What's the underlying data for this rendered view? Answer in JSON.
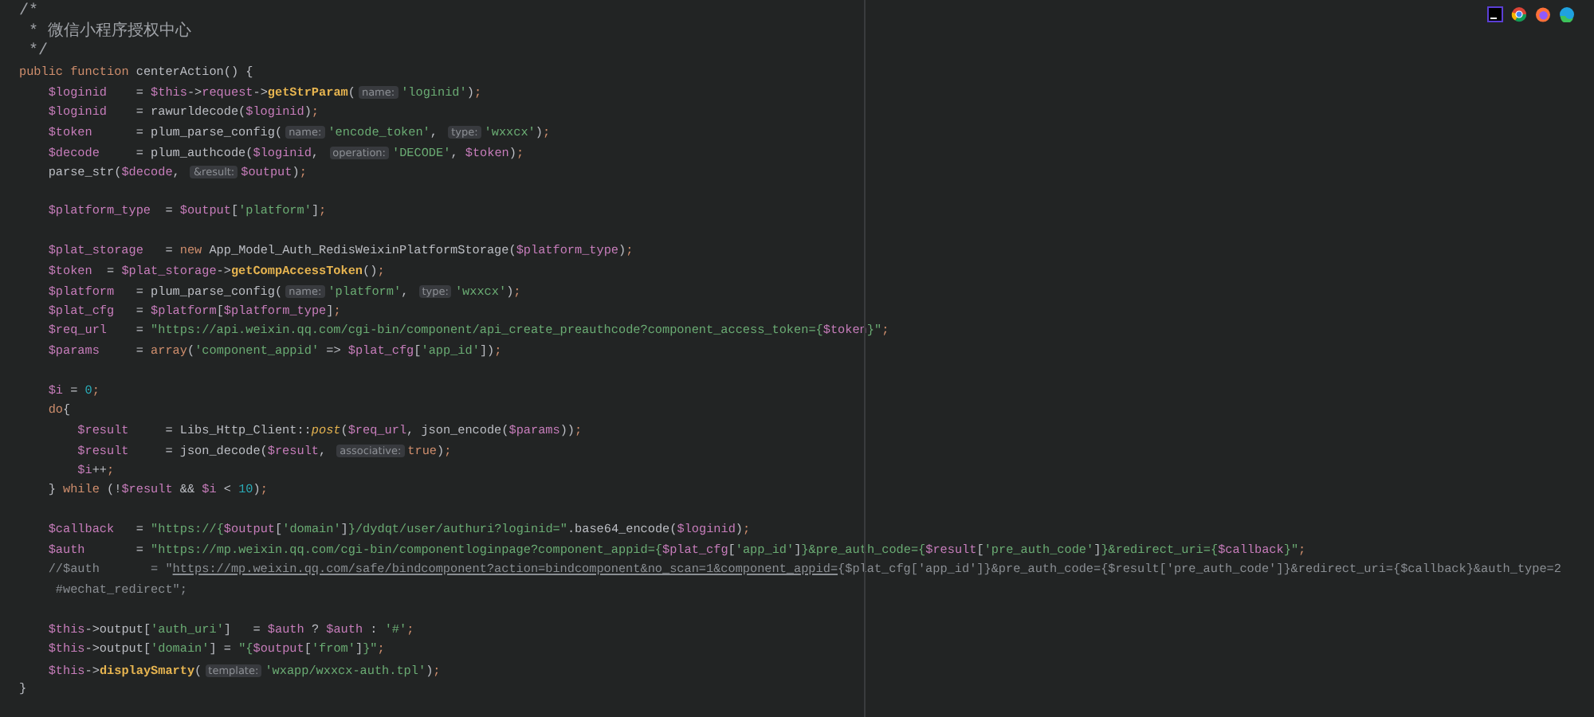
{
  "editor": {
    "lines": [
      {
        "kind": "code",
        "segments": [
          {
            "kind": "doc",
            "text": "/*"
          }
        ]
      },
      {
        "kind": "code",
        "segments": [
          {
            "kind": "doc",
            "text": " * 微信小程序授权中心"
          }
        ]
      },
      {
        "kind": "code",
        "segments": [
          {
            "kind": "doc",
            "text": " */"
          }
        ]
      },
      {
        "kind": "code",
        "segments": [
          {
            "kind": "kw",
            "text": "public function "
          },
          {
            "kind": "plain",
            "text": "centerAction() {"
          }
        ],
        "children": [
          {
            "kind": "code",
            "segments": [
              {
                "kind": "var",
                "text": "$loginid"
              },
              {
                "kind": "plain",
                "text": "    = "
              },
              {
                "kind": "var",
                "text": "$this"
              },
              {
                "kind": "plain",
                "text": "->"
              },
              {
                "kind": "var",
                "text": "request"
              },
              {
                "kind": "plain",
                "text": "->"
              },
              {
                "kind": "call",
                "text": "getStrParam"
              },
              {
                "kind": "plain",
                "text": "("
              },
              {
                "kind": "hint",
                "text": "name:"
              },
              {
                "kind": "str",
                "text": "'loginid'"
              },
              {
                "kind": "plain",
                "text": ")"
              },
              {
                "kind": "kw",
                "text": ";"
              }
            ]
          },
          {
            "kind": "code",
            "segments": [
              {
                "kind": "var",
                "text": "$loginid"
              },
              {
                "kind": "plain",
                "text": "    = rawurldecode("
              },
              {
                "kind": "var",
                "text": "$loginid"
              },
              {
                "kind": "plain",
                "text": ")"
              },
              {
                "kind": "kw",
                "text": ";"
              }
            ]
          },
          {
            "kind": "code",
            "segments": [
              {
                "kind": "var",
                "text": "$token"
              },
              {
                "kind": "plain",
                "text": "      = plum_parse_config("
              },
              {
                "kind": "hint",
                "text": "name:"
              },
              {
                "kind": "str",
                "text": "'encode_token'"
              },
              {
                "kind": "plain",
                "text": ", "
              },
              {
                "kind": "hint",
                "text": "type:"
              },
              {
                "kind": "str",
                "text": "'wxxcx'"
              },
              {
                "kind": "plain",
                "text": ")"
              },
              {
                "kind": "kw",
                "text": ";"
              }
            ]
          },
          {
            "kind": "code",
            "segments": [
              {
                "kind": "var",
                "text": "$decode"
              },
              {
                "kind": "plain",
                "text": "     = plum_authcode("
              },
              {
                "kind": "var",
                "text": "$loginid"
              },
              {
                "kind": "plain",
                "text": ", "
              },
              {
                "kind": "hint",
                "text": "operation:"
              },
              {
                "kind": "str",
                "text": "'DECODE'"
              },
              {
                "kind": "plain",
                "text": ", "
              },
              {
                "kind": "var",
                "text": "$token"
              },
              {
                "kind": "plain",
                "text": ")"
              },
              {
                "kind": "kw",
                "text": ";"
              }
            ]
          },
          {
            "kind": "code",
            "segments": [
              {
                "kind": "plain",
                "text": "parse_str("
              },
              {
                "kind": "var",
                "text": "$decode"
              },
              {
                "kind": "plain",
                "text": ", "
              },
              {
                "kind": "hint",
                "text": "&result:"
              },
              {
                "kind": "var",
                "text": "$output"
              },
              {
                "kind": "plain",
                "text": ")"
              },
              {
                "kind": "kw",
                "text": ";"
              }
            ]
          },
          {
            "kind": "blank"
          },
          {
            "kind": "code",
            "segments": [
              {
                "kind": "var",
                "text": "$platform_type"
              },
              {
                "kind": "plain",
                "text": "  = "
              },
              {
                "kind": "var",
                "text": "$output"
              },
              {
                "kind": "plain",
                "text": "["
              },
              {
                "kind": "str",
                "text": "'platform'"
              },
              {
                "kind": "plain",
                "text": "]"
              },
              {
                "kind": "kw",
                "text": ";"
              }
            ]
          },
          {
            "kind": "blank"
          },
          {
            "kind": "code",
            "segments": [
              {
                "kind": "var",
                "text": "$plat_storage"
              },
              {
                "kind": "plain",
                "text": "   = "
              },
              {
                "kind": "kw",
                "text": "new"
              },
              {
                "kind": "plain",
                "text": " App_Model_Auth_RedisWeixinPlatformStorage("
              },
              {
                "kind": "var",
                "text": "$platform_type"
              },
              {
                "kind": "plain",
                "text": ")"
              },
              {
                "kind": "kw",
                "text": ";"
              }
            ]
          },
          {
            "kind": "code",
            "segments": [
              {
                "kind": "var",
                "text": "$token"
              },
              {
                "kind": "plain",
                "text": "  = "
              },
              {
                "kind": "var",
                "text": "$plat_storage"
              },
              {
                "kind": "plain",
                "text": "->"
              },
              {
                "kind": "call",
                "text": "getCompAccessToken"
              },
              {
                "kind": "plain",
                "text": "()"
              },
              {
                "kind": "kw",
                "text": ";"
              }
            ]
          },
          {
            "kind": "code",
            "segments": [
              {
                "kind": "var",
                "text": "$platform"
              },
              {
                "kind": "plain",
                "text": "   = plum_parse_config("
              },
              {
                "kind": "hint",
                "text": "name:"
              },
              {
                "kind": "str",
                "text": "'platform'"
              },
              {
                "kind": "plain",
                "text": ", "
              },
              {
                "kind": "hint",
                "text": "type:"
              },
              {
                "kind": "str",
                "text": "'wxxcx'"
              },
              {
                "kind": "plain",
                "text": ")"
              },
              {
                "kind": "kw",
                "text": ";"
              }
            ]
          },
          {
            "kind": "code",
            "segments": [
              {
                "kind": "var",
                "text": "$plat_cfg"
              },
              {
                "kind": "plain",
                "text": "   = "
              },
              {
                "kind": "var",
                "text": "$platform"
              },
              {
                "kind": "plain",
                "text": "["
              },
              {
                "kind": "var",
                "text": "$platform_type"
              },
              {
                "kind": "plain",
                "text": "]"
              },
              {
                "kind": "kw",
                "text": ";"
              }
            ]
          },
          {
            "kind": "code",
            "segments": [
              {
                "kind": "var",
                "text": "$req_url"
              },
              {
                "kind": "plain",
                "text": "    = "
              },
              {
                "kind": "str",
                "text": "\"https://api.weixin.qq.com/cgi-bin/component/api_create_preauthcode?component_access_token={"
              },
              {
                "kind": "var",
                "text": "$token"
              },
              {
                "kind": "str",
                "text": "}\""
              },
              {
                "kind": "kw",
                "text": ";"
              }
            ]
          },
          {
            "kind": "code",
            "segments": [
              {
                "kind": "var",
                "text": "$params"
              },
              {
                "kind": "plain",
                "text": "     = "
              },
              {
                "kind": "kw",
                "text": "array"
              },
              {
                "kind": "plain",
                "text": "("
              },
              {
                "kind": "str",
                "text": "'component_appid'"
              },
              {
                "kind": "plain",
                "text": " => "
              },
              {
                "kind": "var",
                "text": "$plat_cfg"
              },
              {
                "kind": "plain",
                "text": "["
              },
              {
                "kind": "str",
                "text": "'app_id'"
              },
              {
                "kind": "plain",
                "text": "])"
              },
              {
                "kind": "kw",
                "text": ";"
              }
            ]
          },
          {
            "kind": "blank"
          },
          {
            "kind": "code",
            "segments": [
              {
                "kind": "var",
                "text": "$i"
              },
              {
                "kind": "plain",
                "text": " = "
              },
              {
                "kind": "num",
                "text": "0"
              },
              {
                "kind": "kw",
                "text": ";"
              }
            ]
          },
          {
            "kind": "code",
            "segments": [
              {
                "kind": "kw",
                "text": "do"
              },
              {
                "kind": "plain",
                "text": "{"
              }
            ],
            "children": [
              {
                "kind": "code",
                "segments": [
                  {
                    "kind": "var",
                    "text": "$result"
                  },
                  {
                    "kind": "plain",
                    "text": "     = Libs_Http_Client::"
                  },
                  {
                    "kind": "fnit",
                    "text": "post"
                  },
                  {
                    "kind": "plain",
                    "text": "("
                  },
                  {
                    "kind": "var",
                    "text": "$req_url"
                  },
                  {
                    "kind": "plain",
                    "text": ", json_encode("
                  },
                  {
                    "kind": "var",
                    "text": "$params"
                  },
                  {
                    "kind": "plain",
                    "text": "))"
                  },
                  {
                    "kind": "kw",
                    "text": ";"
                  }
                ]
              },
              {
                "kind": "code",
                "segments": [
                  {
                    "kind": "var",
                    "text": "$result"
                  },
                  {
                    "kind": "plain",
                    "text": "     = json_decode("
                  },
                  {
                    "kind": "var",
                    "text": "$result"
                  },
                  {
                    "kind": "plain",
                    "text": ", "
                  },
                  {
                    "kind": "hint",
                    "text": "associative:"
                  },
                  {
                    "kind": "kw",
                    "text": "true"
                  },
                  {
                    "kind": "plain",
                    "text": ")"
                  },
                  {
                    "kind": "kw",
                    "text": ";"
                  }
                ]
              },
              {
                "kind": "code",
                "segments": [
                  {
                    "kind": "var",
                    "text": "$i"
                  },
                  {
                    "kind": "plain",
                    "text": "++"
                  },
                  {
                    "kind": "kw",
                    "text": ";"
                  }
                ]
              }
            ]
          },
          {
            "kind": "code",
            "segments": [
              {
                "kind": "plain",
                "text": "} "
              },
              {
                "kind": "kw",
                "text": "while"
              },
              {
                "kind": "plain",
                "text": " (!"
              },
              {
                "kind": "var",
                "text": "$result"
              },
              {
                "kind": "plain",
                "text": " && "
              },
              {
                "kind": "var",
                "text": "$i"
              },
              {
                "kind": "plain",
                "text": " < "
              },
              {
                "kind": "num",
                "text": "10"
              },
              {
                "kind": "plain",
                "text": ")"
              },
              {
                "kind": "kw",
                "text": ";"
              }
            ]
          },
          {
            "kind": "blank"
          },
          {
            "kind": "code",
            "segments": [
              {
                "kind": "var",
                "text": "$callback"
              },
              {
                "kind": "plain",
                "text": "   = "
              },
              {
                "kind": "str",
                "text": "\"https://{"
              },
              {
                "kind": "var",
                "text": "$output"
              },
              {
                "kind": "plain",
                "text": "["
              },
              {
                "kind": "str",
                "text": "'domain'"
              },
              {
                "kind": "plain",
                "text": "]"
              },
              {
                "kind": "str",
                "text": "}/dydqt/user/authuri?loginid=\""
              },
              {
                "kind": "plain",
                "text": ".base64_encode("
              },
              {
                "kind": "var",
                "text": "$loginid"
              },
              {
                "kind": "plain",
                "text": ")"
              },
              {
                "kind": "kw",
                "text": ";"
              }
            ]
          },
          {
            "kind": "code",
            "segments": [
              {
                "kind": "var",
                "text": "$auth"
              },
              {
                "kind": "plain",
                "text": "       = "
              },
              {
                "kind": "str",
                "text": "\"https://mp.weixin.qq.com/cgi-bin/componentloginpage?component_appid={"
              },
              {
                "kind": "var",
                "text": "$plat_cfg"
              },
              {
                "kind": "plain",
                "text": "["
              },
              {
                "kind": "str",
                "text": "'app_id'"
              },
              {
                "kind": "plain",
                "text": "]"
              },
              {
                "kind": "str",
                "text": "}&pre_auth_code={"
              },
              {
                "kind": "var",
                "text": "$result"
              },
              {
                "kind": "plain",
                "text": "["
              },
              {
                "kind": "str",
                "text": "'pre_auth_code'"
              },
              {
                "kind": "plain",
                "text": "]"
              },
              {
                "kind": "str",
                "text": "}&redirect_uri={"
              },
              {
                "kind": "var",
                "text": "$callback"
              },
              {
                "kind": "str",
                "text": "}\""
              },
              {
                "kind": "kw",
                "text": ";"
              }
            ]
          },
          {
            "kind": "code",
            "segments": [
              {
                "kind": "comment",
                "text": "//$auth       = \""
              },
              {
                "kind": "link",
                "text": "https://mp.weixin.qq.com/safe/bindcomponent?action=bindcomponent&no_scan=1&component_appid="
              },
              {
                "kind": "comment",
                "text": "{$plat_cfg['app_id']}&pre_auth_code={$result['pre_auth_code']}&redirect_uri={$callback}&auth_type=2"
              }
            ]
          },
          {
            "kind": "code",
            "segments": [
              {
                "kind": "comment",
                "text": " #wechat_redirect\";"
              }
            ]
          },
          {
            "kind": "blank"
          },
          {
            "kind": "code",
            "segments": [
              {
                "kind": "var",
                "text": "$this"
              },
              {
                "kind": "plain",
                "text": "->output["
              },
              {
                "kind": "str",
                "text": "'auth_uri'"
              },
              {
                "kind": "plain",
                "text": "]   = "
              },
              {
                "kind": "var",
                "text": "$auth"
              },
              {
                "kind": "plain",
                "text": " ? "
              },
              {
                "kind": "var",
                "text": "$auth"
              },
              {
                "kind": "plain",
                "text": " : "
              },
              {
                "kind": "str",
                "text": "'#'"
              },
              {
                "kind": "kw",
                "text": ";"
              }
            ]
          },
          {
            "kind": "code",
            "segments": [
              {
                "kind": "var",
                "text": "$this"
              },
              {
                "kind": "plain",
                "text": "->output["
              },
              {
                "kind": "str",
                "text": "'domain'"
              },
              {
                "kind": "plain",
                "text": "] = "
              },
              {
                "kind": "str",
                "text": "\"{"
              },
              {
                "kind": "var",
                "text": "$output"
              },
              {
                "kind": "plain",
                "text": "["
              },
              {
                "kind": "str",
                "text": "'from'"
              },
              {
                "kind": "plain",
                "text": "]"
              },
              {
                "kind": "str",
                "text": "}\""
              },
              {
                "kind": "kw",
                "text": ";"
              }
            ]
          },
          {
            "kind": "code",
            "segments": [
              {
                "kind": "var",
                "text": "$this"
              },
              {
                "kind": "plain",
                "text": "->"
              },
              {
                "kind": "call",
                "text": "displaySmarty"
              },
              {
                "kind": "plain",
                "text": "("
              },
              {
                "kind": "hint",
                "text": "template:"
              },
              {
                "kind": "str",
                "text": "'wxapp/wxxcx-auth.tpl'"
              },
              {
                "kind": "plain",
                "text": ")"
              },
              {
                "kind": "kw",
                "text": ";"
              }
            ]
          }
        ]
      },
      {
        "kind": "code",
        "segments": [
          {
            "kind": "plain",
            "text": "}"
          }
        ]
      }
    ]
  }
}
